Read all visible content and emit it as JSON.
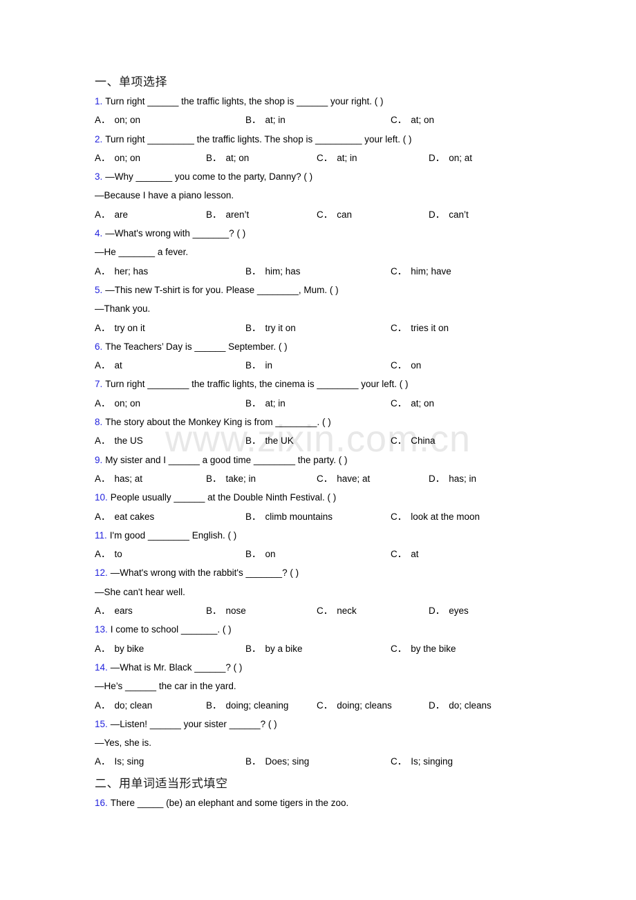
{
  "watermark": {
    "text": "www.zixin.com.cn",
    "color": "#e8e8e8"
  },
  "accent": {
    "question_number_color": "#2222dd",
    "text_color": "#000000",
    "page_background": "#ffffff"
  },
  "sections": [
    {
      "header": "一、单项选择",
      "questions": [
        {
          "number": "1.",
          "text": "Turn right ______ the traffic lights, the shop is ______ your right. (   )",
          "continuation": null,
          "options": [
            {
              "letter": "A．",
              "text": "on; on"
            },
            {
              "letter": "B．",
              "text": "at; in"
            },
            {
              "letter": "C．",
              "text": "at; on"
            }
          ]
        },
        {
          "number": "2.",
          "text": "Turn right _________ the traffic lights. The shop is _________ your left. (    )",
          "continuation": null,
          "options": [
            {
              "letter": "A．",
              "text": "on; on"
            },
            {
              "letter": "B．",
              "text": "at; on"
            },
            {
              "letter": "C．",
              "text": "at; in"
            },
            {
              "letter": "D．",
              "text": "on; at"
            }
          ]
        },
        {
          "number": "3.",
          "text": "—Why _______ you come to the party, Danny? (  )",
          "continuation": "—Because I have a piano lesson.",
          "options": [
            {
              "letter": "A．",
              "text": "are"
            },
            {
              "letter": "B．",
              "text": "aren’t"
            },
            {
              "letter": "C．",
              "text": "can"
            },
            {
              "letter": "D．",
              "text": "can’t"
            }
          ]
        },
        {
          "number": "4.",
          "text": "—What's wrong with _______? (  )",
          "continuation": "—He _______ a fever.",
          "options": [
            {
              "letter": "A．",
              "text": "her; has"
            },
            {
              "letter": "B．",
              "text": "him; has"
            },
            {
              "letter": "C．",
              "text": "him; have"
            }
          ]
        },
        {
          "number": "5.",
          "text": "—This new T-shirt is for you. Please ________, Mum. (    )",
          "continuation": "—Thank you.",
          "options": [
            {
              "letter": "A．",
              "text": "try on it"
            },
            {
              "letter": "B．",
              "text": "try it on"
            },
            {
              "letter": "C．",
              "text": "tries it on"
            }
          ]
        },
        {
          "number": "6.",
          "text": "The Teachers’ Day is ______ September. (  )",
          "continuation": null,
          "options": [
            {
              "letter": "A．",
              "text": "at"
            },
            {
              "letter": "B．",
              "text": "in"
            },
            {
              "letter": "C．",
              "text": "on"
            }
          ]
        },
        {
          "number": "7.",
          "text": "Turn right ________ the traffic lights, the cinema is ________ your left. (  )",
          "continuation": null,
          "options": [
            {
              "letter": "A．",
              "text": "on; on"
            },
            {
              "letter": "B．",
              "text": "at; in"
            },
            {
              "letter": "C．",
              "text": "at; on"
            }
          ]
        },
        {
          "number": "8.",
          "text": "The story about the Monkey King is from ________. (   )",
          "continuation": null,
          "options": [
            {
              "letter": "A．",
              "text": "the US"
            },
            {
              "letter": "B．",
              "text": "the UK"
            },
            {
              "letter": "C．",
              "text": "China"
            }
          ]
        },
        {
          "number": "9.",
          "text": "My sister and I ______ a good time ________ the party. (  )",
          "continuation": null,
          "options": [
            {
              "letter": "A．",
              "text": "has; at"
            },
            {
              "letter": "B．",
              "text": "take; in"
            },
            {
              "letter": "C．",
              "text": "have; at"
            },
            {
              "letter": "D．",
              "text": "has; in"
            }
          ]
        },
        {
          "number": "10.",
          "text": "People usually ______ at the Double Ninth Festival. (   )",
          "continuation": null,
          "options": [
            {
              "letter": "A．",
              "text": "eat cakes"
            },
            {
              "letter": "B．",
              "text": "climb mountains"
            },
            {
              "letter": "C．",
              "text": "look at the moon"
            }
          ]
        },
        {
          "number": "11.",
          "text": "I'm good ________ English. (  )",
          "continuation": null,
          "options": [
            {
              "letter": "A．",
              "text": "to"
            },
            {
              "letter": "B．",
              "text": "on"
            },
            {
              "letter": "C．",
              "text": "at"
            }
          ]
        },
        {
          "number": "12.",
          "text": "—What's wrong with the rabbit's _______? (  )",
          "continuation": "—She can't hear well.",
          "options": [
            {
              "letter": "A．",
              "text": "ears"
            },
            {
              "letter": "B．",
              "text": "nose"
            },
            {
              "letter": "C．",
              "text": "neck"
            },
            {
              "letter": "D．",
              "text": "eyes"
            }
          ]
        },
        {
          "number": "13.",
          "text": "I come to school _______. (  )",
          "continuation": null,
          "options": [
            {
              "letter": "A．",
              "text": "by bike"
            },
            {
              "letter": "B．",
              "text": "by a bike"
            },
            {
              "letter": "C．",
              "text": "by the bike"
            }
          ]
        },
        {
          "number": "14.",
          "text": "—What is Mr. Black ______? (   )",
          "continuation": "—He’s ______ the car in the yard.",
          "options": [
            {
              "letter": "A．",
              "text": "do; clean"
            },
            {
              "letter": "B．",
              "text": "doing; cleaning"
            },
            {
              "letter": "C．",
              "text": "doing; cleans"
            },
            {
              "letter": "D．",
              "text": "do; cleans"
            }
          ]
        },
        {
          "number": "15.",
          "text": "—Listen! ______ your sister ______? (   )",
          "continuation": "—Yes, she is.",
          "options": [
            {
              "letter": "A．",
              "text": "Is; sing"
            },
            {
              "letter": "B．",
              "text": "Does; sing"
            },
            {
              "letter": "C．",
              "text": "Is; singing"
            }
          ]
        }
      ]
    },
    {
      "header": "二、用单词适当形式填空",
      "questions": [
        {
          "number": "16.",
          "text": "There _____ (be) an elephant and some tigers in the zoo.",
          "continuation": null,
          "options": []
        }
      ]
    }
  ]
}
